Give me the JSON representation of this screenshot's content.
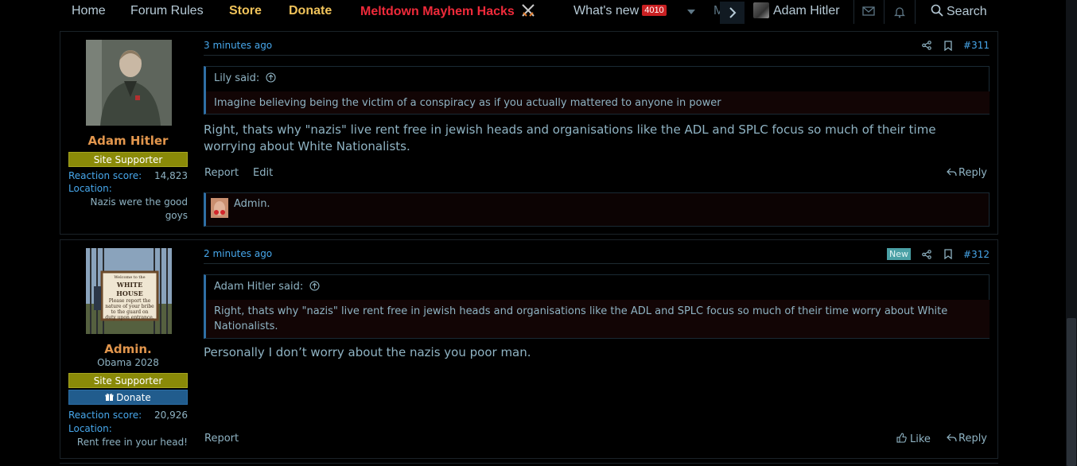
{
  "nav": {
    "home": "Home",
    "forum_rules": "Forum Rules",
    "store": "Store",
    "donate": "Donate",
    "hacks": "Meltdown Mayhem Hacks",
    "whats_new": "What's new",
    "whats_new_count": "4010",
    "more_truncated": "M",
    "user": "Adam Hitler",
    "search": "Search"
  },
  "posts": [
    {
      "username": "Adam Hitler",
      "banner": "Site Supporter",
      "reaction_label": "Reaction score:",
      "reaction_score": "14,823",
      "location_label": "Location:",
      "location": "Nazis were the good goys",
      "time": "3 minutes ago",
      "post_number": "#311",
      "quote_author": "Lily said:",
      "quote_text": "Imagine believing being the victim of a conspiracy as if you actually mattered to anyone in power",
      "body": "Right, thats why \"nazis\" live rent free in jewish heads and organisations like the ADL and SPLC focus so much of their time worrying about White Nationalists.",
      "report": "Report",
      "edit": "Edit",
      "reply": "Reply",
      "reacted_by": "Admin."
    },
    {
      "username": "Admin.",
      "user_title": "Obama 2028",
      "banner": "Site Supporter",
      "donate_banner": "Donate",
      "reaction_label": "Reaction score:",
      "reaction_score": "20,926",
      "location_label": "Location:",
      "location": "Rent free in your head!",
      "time": "2 minutes ago",
      "new_badge": "New",
      "post_number": "#312",
      "quote_author": "Adam Hitler said:",
      "quote_text": "Right, thats why \"nazis\" live rent free in jewish heads and organisations like the ADL and SPLC focus so much of their time worry about White Nationalists.",
      "body": "Personally I don’t worry about the nazis you poor man.",
      "report": "Report",
      "like": "Like",
      "reply": "Reply",
      "avatar_sign_lines": [
        "Welcome to the",
        "WHITE HOUSE",
        "Please report the",
        "nature of your bribe",
        "to the guard on",
        "duty upon entrance."
      ]
    }
  ],
  "colors": {
    "accent_link": "#47a7eb",
    "username": "#e2964d",
    "badge_red": "#c92022",
    "site_supporter": "#8a8a08",
    "donate": "#215c8d",
    "hacks_link": "#ef2a3a",
    "store_donate_link": "#f0c35a"
  },
  "icons": [
    "crossed-swords-icon",
    "chevron-down-icon",
    "chevron-right-icon",
    "envelope-icon",
    "bell-icon",
    "search-icon",
    "share-icon",
    "bookmark-icon",
    "reply-icon",
    "thumbs-up-icon",
    "gift-icon",
    "arrow-up-circle-icon"
  ]
}
